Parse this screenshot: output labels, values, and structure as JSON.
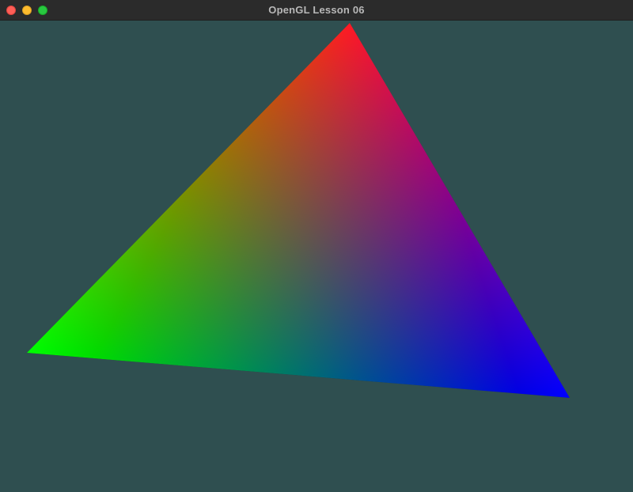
{
  "window": {
    "title": "OpenGL Lesson 06",
    "background_color": "#2f4f50",
    "controls": [
      "close-button",
      "minimize-button",
      "zoom-button"
    ]
  },
  "scene": {
    "shape": "triangle",
    "vertex_colors": {
      "top": "#ff0000",
      "left": "#00ff00",
      "right": "#0000ff"
    }
  }
}
